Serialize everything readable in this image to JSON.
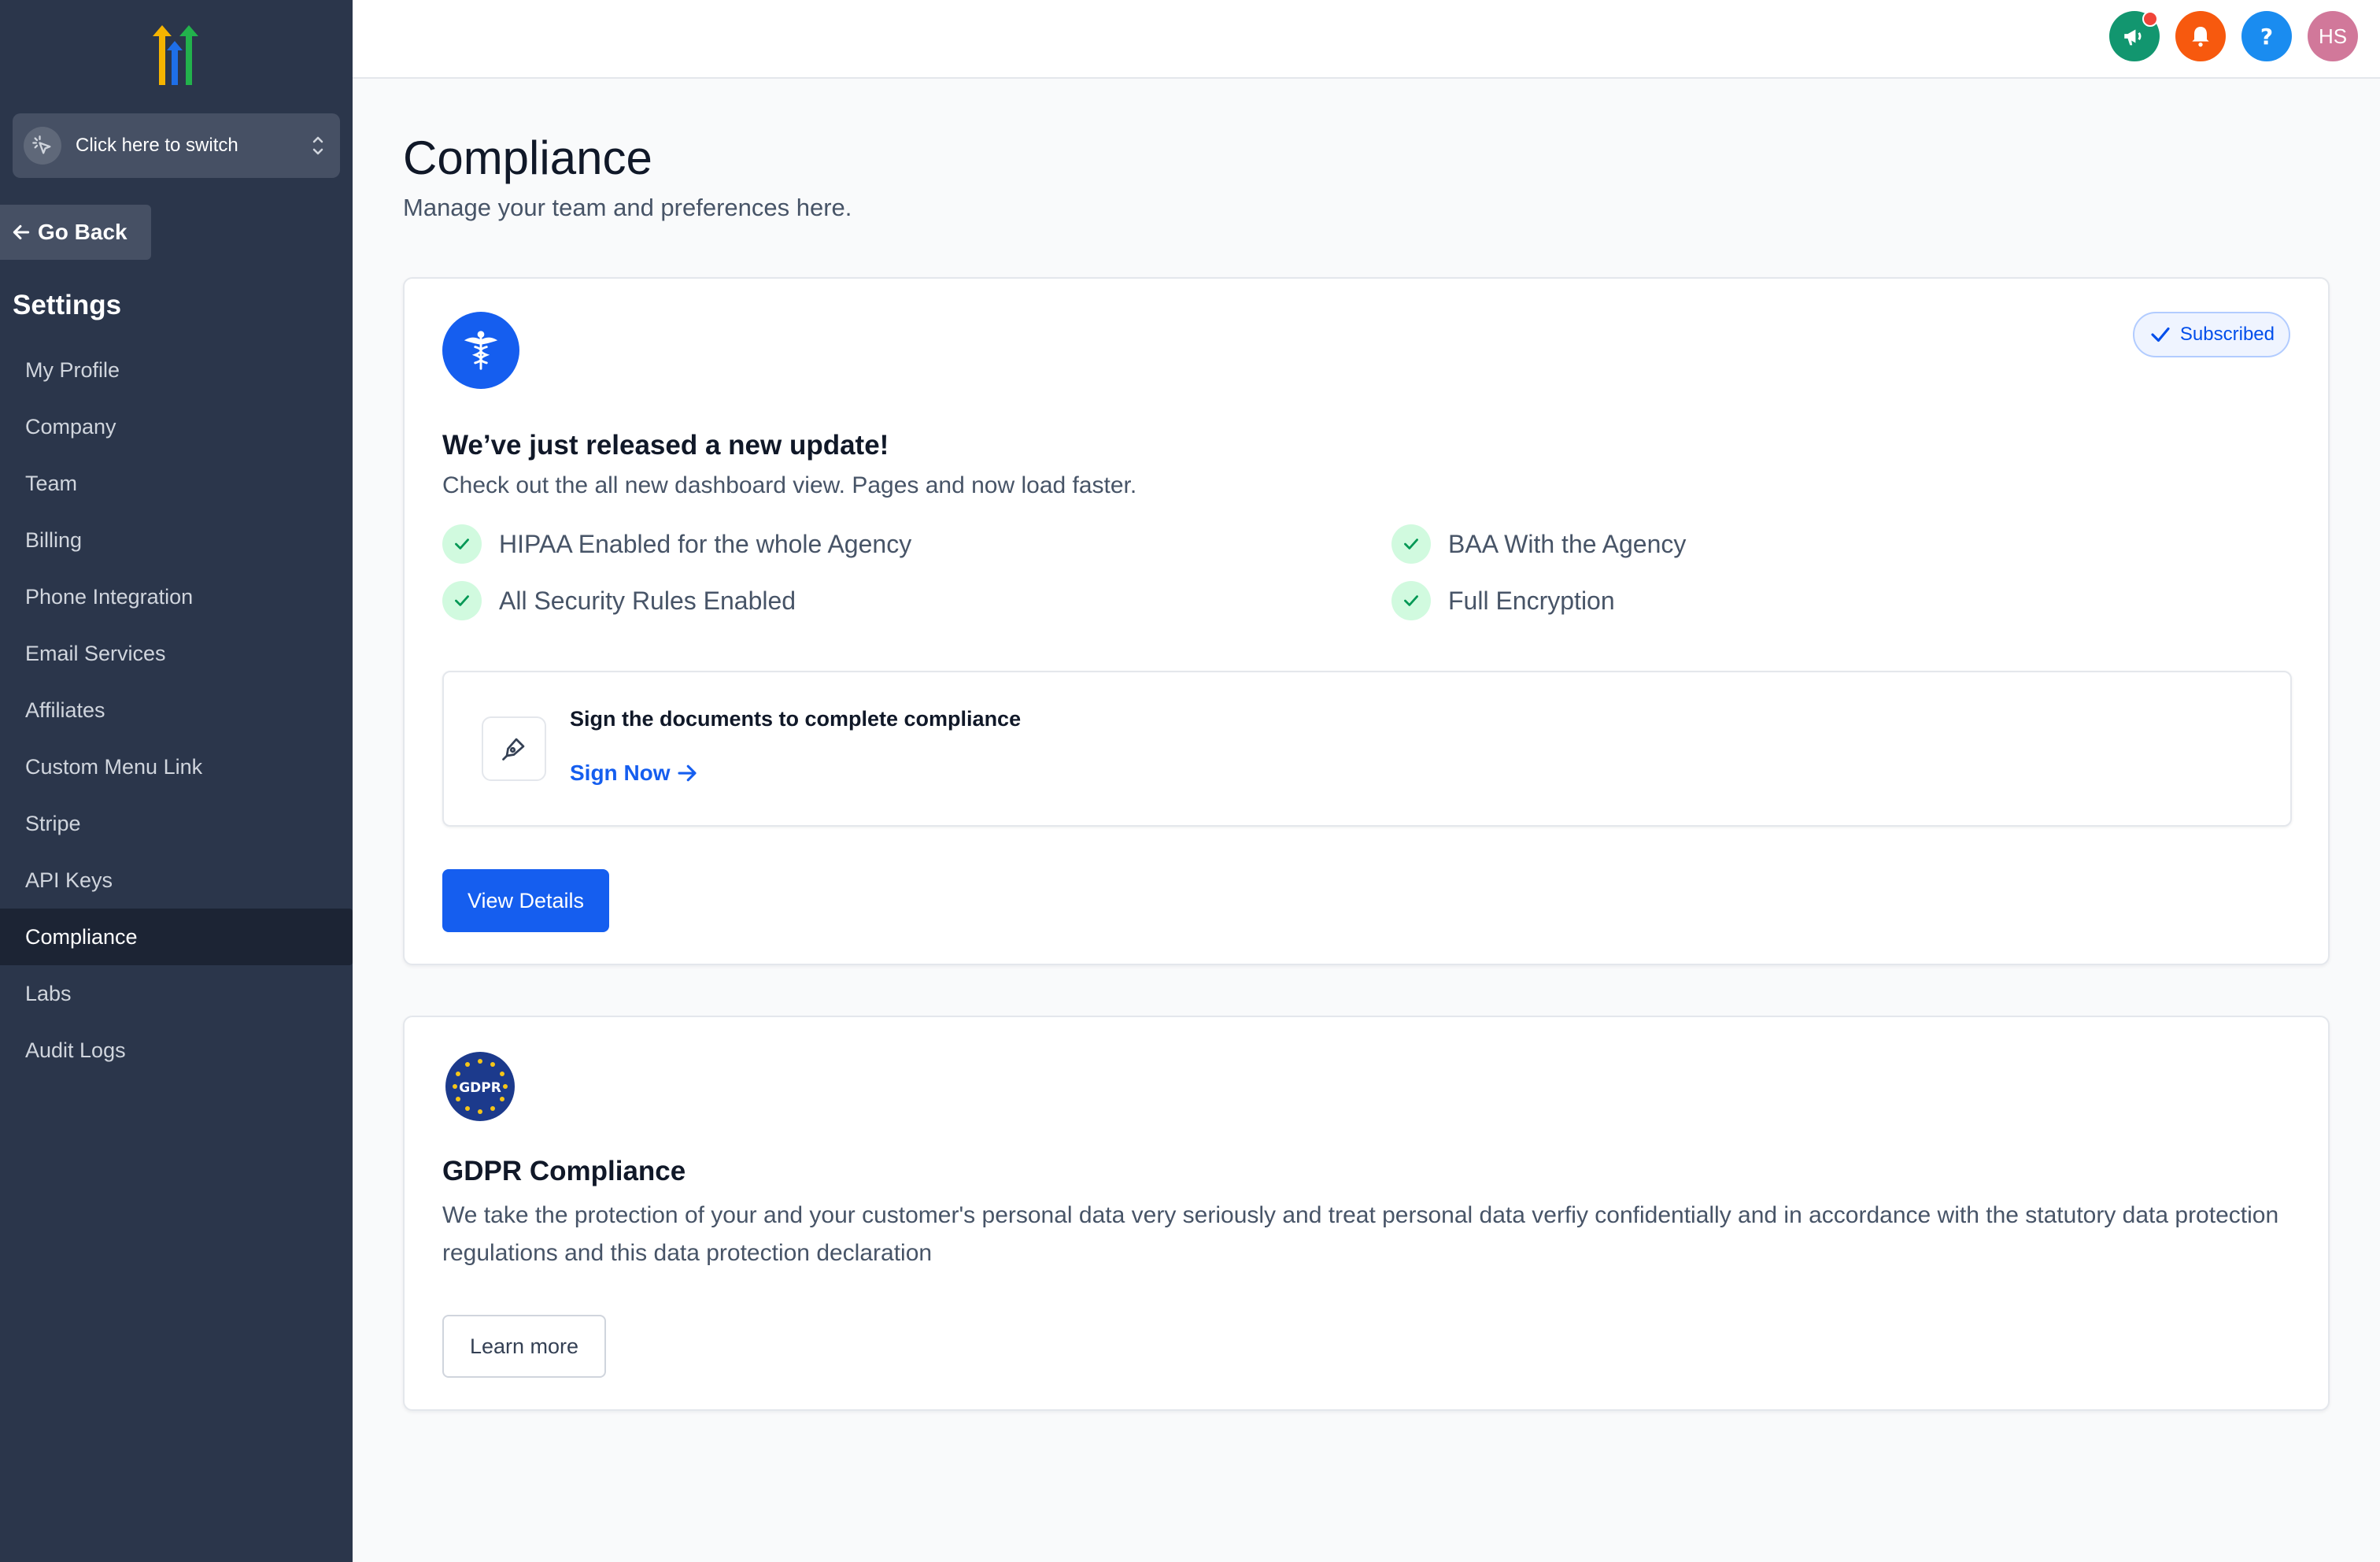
{
  "app": {
    "brand_colors": {
      "sidebar_bg": "#2b364b",
      "accent": "#155eef",
      "success": "#12b76a"
    }
  },
  "sidebar": {
    "switcher_label": "Click here to switch",
    "go_back_label": "Go Back",
    "section_title": "Settings",
    "items": [
      {
        "label": "My Profile",
        "active": false
      },
      {
        "label": "Company",
        "active": false
      },
      {
        "label": "Team",
        "active": false
      },
      {
        "label": "Billing",
        "active": false
      },
      {
        "label": "Phone Integration",
        "active": false
      },
      {
        "label": "Email Services",
        "active": false
      },
      {
        "label": "Affiliates",
        "active": false
      },
      {
        "label": "Custom Menu Link",
        "active": false
      },
      {
        "label": "Stripe",
        "active": false
      },
      {
        "label": "API Keys",
        "active": false
      },
      {
        "label": "Compliance",
        "active": true
      },
      {
        "label": "Labs",
        "active": false
      },
      {
        "label": "Audit Logs",
        "active": false
      }
    ]
  },
  "header": {
    "icons": [
      "megaphone-icon",
      "bell-icon",
      "help-icon"
    ],
    "avatar_initials": "HS"
  },
  "page": {
    "title": "Compliance",
    "subtitle": "Manage your team and preferences here."
  },
  "hipaa_card": {
    "badge_status": "Subscribed",
    "title": "We’ve just released a new update!",
    "subtitle": "Check out the all new dashboard view. Pages and now load faster.",
    "features": [
      "HIPAA Enabled for the whole Agency",
      "BAA With the Agency",
      "All Security Rules Enabled",
      "Full Encryption"
    ],
    "sign_title": "Sign the documents to complete compliance",
    "sign_link": "Sign Now",
    "button_label": "View Details"
  },
  "gdpr_card": {
    "badge_text": "GDPR",
    "title": "GDPR Compliance",
    "description": "We take the protection of your and your customer's personal data very seriously and treat personal data verfiy confidentially and in accordance with the statutory data protection regulations and this data protection declaration",
    "button_label": "Learn more"
  }
}
